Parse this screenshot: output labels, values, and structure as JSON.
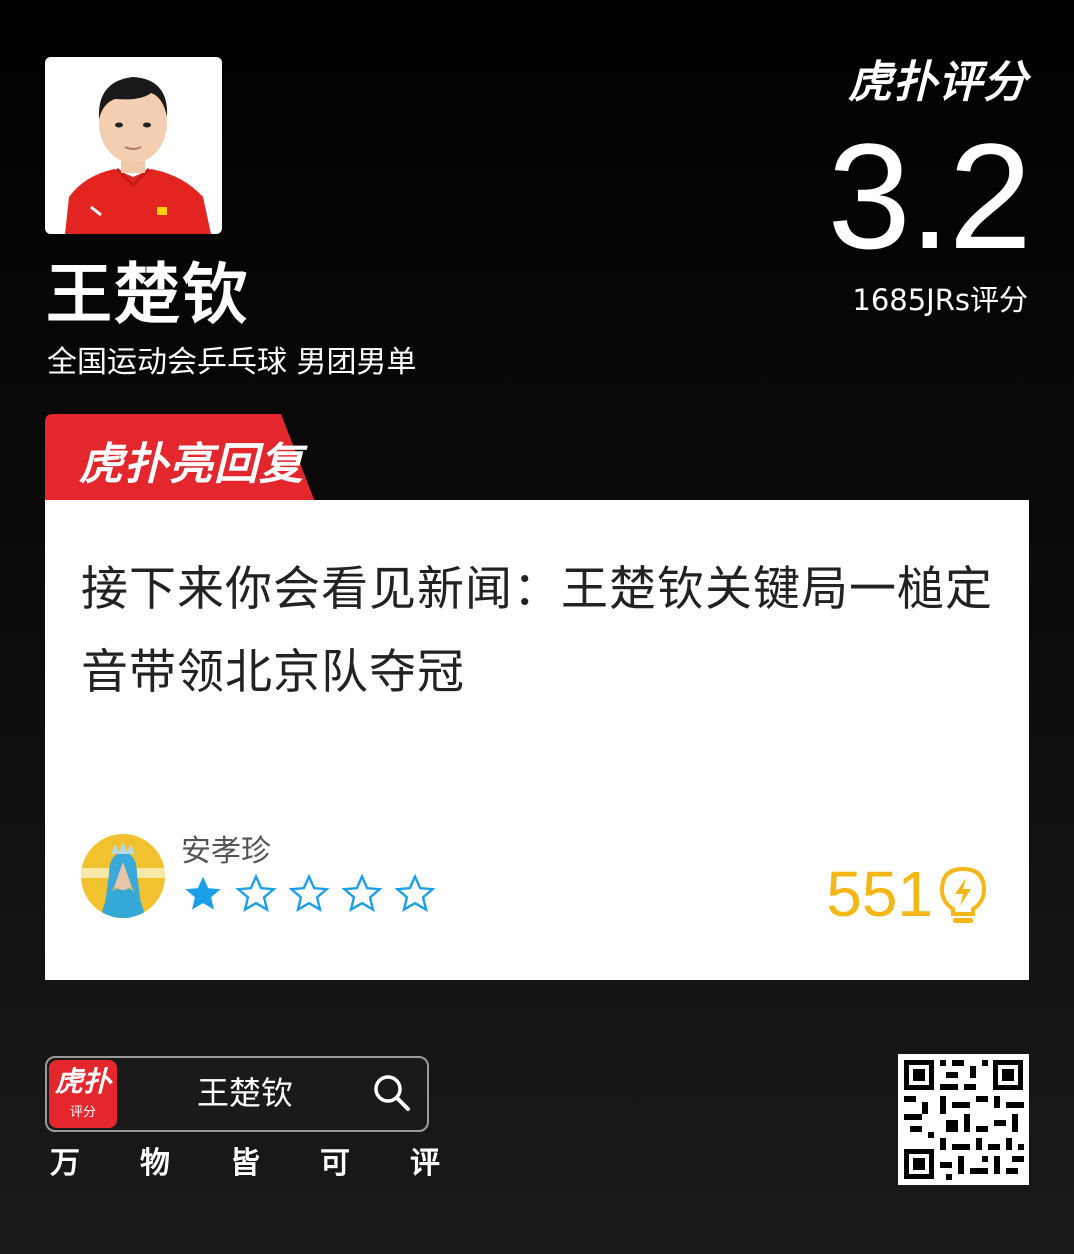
{
  "player": {
    "name": "王楚钦",
    "event": "全国运动会乒乓球 男团男单",
    "photo": "player-photo"
  },
  "brand": {
    "logo_text": "虎扑评分",
    "logo_superscript": "JR"
  },
  "rating": {
    "score": "3.2",
    "count_text": "1685JRs评分"
  },
  "highlight": {
    "tab_label": "虎扑亮回复",
    "tab_superscript": "JR",
    "accent_color": "#e4262d",
    "comment": "接下来你会看见新闻：王楚钦关键局一槌定音带领北京队夺冠",
    "author": {
      "name": "安孝珍",
      "avatar": "user-avatar",
      "stars": 1,
      "max_stars": 5,
      "star_color": "#1aa0e8"
    },
    "lights": {
      "count": "551",
      "icon": "lightbulb-icon",
      "color": "#f5b716"
    }
  },
  "footer": {
    "app_icon_main": "虎扑",
    "app_icon_sub": "评分",
    "search_text": "王楚钦",
    "search_icon": "search-icon",
    "slogan": [
      "万",
      "物",
      "皆",
      "可",
      "评"
    ],
    "qr": "qr-code"
  }
}
